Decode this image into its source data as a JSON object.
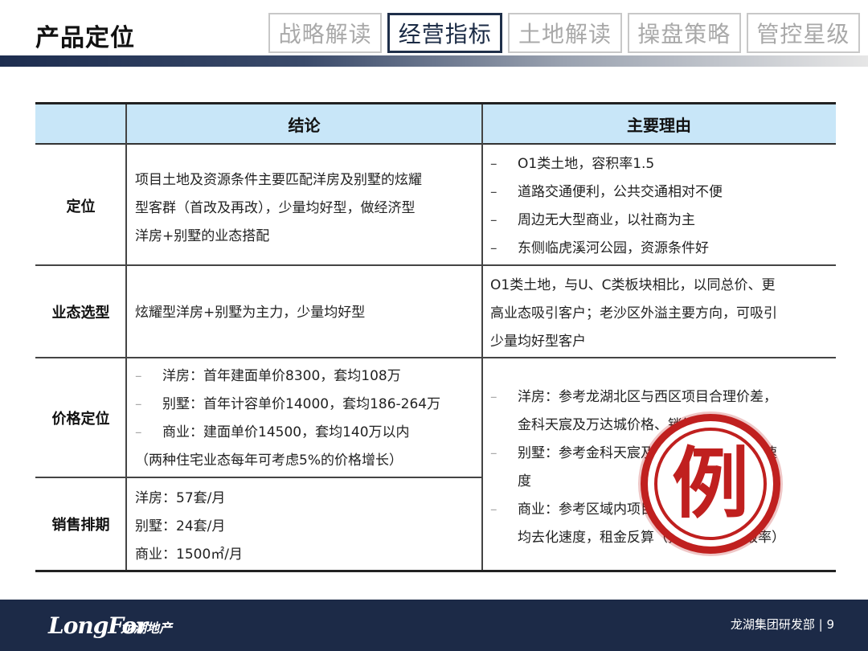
{
  "page": {
    "title": "产品定位"
  },
  "tabs": [
    {
      "label": "战略解读",
      "active": false
    },
    {
      "label": "经营指标",
      "active": true
    },
    {
      "label": "土地解读",
      "active": false
    },
    {
      "label": "操盘策略",
      "active": false
    },
    {
      "label": "管控星级",
      "active": false
    }
  ],
  "table": {
    "headers": {
      "conclusion": "结论",
      "reasons": "主要理由"
    },
    "rows": {
      "positioning": {
        "label": "定位",
        "conclusion": [
          "项目土地及资源条件主要匹配洋房及别墅的炫耀",
          "型客群（首改及再改），少量均好型，做经济型",
          "洋房+别墅的业态搭配"
        ],
        "reasons": [
          "O1类土地，容积率1.5",
          "道路交通便利，公共交通相对不便",
          "周边无大型商业，以社商为主",
          "东侧临虎溪河公园，资源条件好"
        ]
      },
      "format": {
        "label": "业态选型",
        "conclusion": "炫耀型洋房+别墅为主力，少量均好型",
        "reasons": [
          "O1类土地，与U、C类板块相比，以同总价、更",
          "高业态吸引客户；老沙区外溢主要方向，可吸引",
          "少量均好型客户"
        ]
      },
      "pricing": {
        "label": "价格定位",
        "conclusion": [
          "洋房：首年建面单价8300，套均108万",
          "别墅：首年计容单价14000，套均186-264万",
          "商业：建面单价14500，套均140万以内"
        ],
        "note": "（两种住宅业态每年可考虑5%的价格增长）"
      },
      "sales": {
        "label": "销售排期",
        "conclusion": [
          "洋房：57套/月",
          "别墅：24套/月",
          "商业：1500㎡/月"
        ]
      },
      "pricing_sales_reasons": [
        "洋房：参考龙湖北区与西区项目合理价差，",
        "金科天宸及万达城价格、销售速度",
        "别墅：参考金科天宸及万达城价格、销售速",
        "度",
        "商业：参考区域内项目商铺租金水平及平",
        "均去化速度，租金反算（按5%投资回报率）"
      ]
    }
  },
  "stamp": {
    "char": "例"
  },
  "footer": {
    "logo": "LongFor",
    "logo_cn": "龙湖地产",
    "text": "龙湖集团研发部 | 9"
  },
  "colors": {
    "header_fill": "#c8e6f8",
    "stamp": "#c0201f",
    "footer": "#1c2a47"
  }
}
